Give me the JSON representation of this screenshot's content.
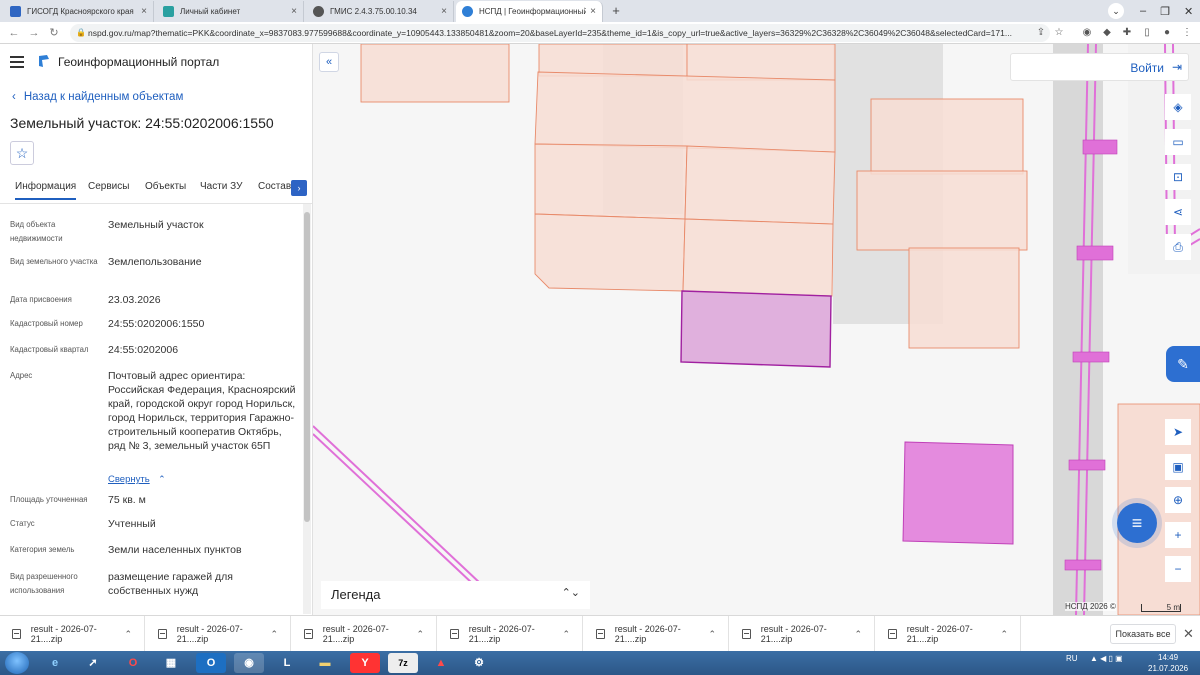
{
  "browser": {
    "tabs": [
      {
        "title": "ГИСОГД Красноярского края",
        "color": "#2f66c2"
      },
      {
        "title": "Личный кабинет",
        "color": "#2aa0a0"
      },
      {
        "title": "ГМИС 2.4.3.75.00.10.34",
        "color": "#555555"
      },
      {
        "title": "НСПД | Геоинформационный п",
        "color": "#2f7fd6"
      }
    ],
    "url": "nspd.gov.ru/map?thematic=PKK&coordinate_x=9837083.977599688&coordinate_y=10905443.133850481&zoom=20&baseLayerId=235&theme_id=1&is_copy_url=true&active_layers=36329%2C36328%2C36049%2C36048&selectedCard=171..."
  },
  "panel": {
    "portal_title": "Геоинформационный портал",
    "back_label": "Назад к найденным объектам",
    "object_title": "Земельный участок: 24:55:0202006:1550",
    "tabs": [
      "Информация",
      "Сервисы",
      "Объекты",
      "Части ЗУ",
      "Состав"
    ],
    "props": [
      {
        "label": "Вид объекта недвижимости",
        "value": "Земельный участок"
      },
      {
        "label": "Вид земельного участка",
        "value": "Землепользование"
      },
      {
        "label": "Дата присвоения",
        "value": "23.03.2026"
      },
      {
        "label": "Кадастровый номер",
        "value": "24:55:0202006:1550"
      },
      {
        "label": "Кадастровый квартал",
        "value": "24:55:0202006"
      },
      {
        "label": "Адрес",
        "value": "Почтовый адрес ориентира: Российская Федерация, Красноярский край, городской округ город Норильск, город Норильск, территория Гаражно-строительный кооператив Октябрь, ряд № 3, земельный участок 65П"
      },
      {
        "label": "Площадь уточненная",
        "value": "75 кв. м"
      },
      {
        "label": "Статус",
        "value": "Учтенный"
      },
      {
        "label": "Категория земель",
        "value": "Земли населенных пунктов"
      },
      {
        "label": "Вид разрешенного использования",
        "value": "размещение гаражей для собственных нужд"
      }
    ],
    "collapse_label": "Свернуть"
  },
  "map": {
    "login_label": "Войти",
    "legend_label": "Легенда",
    "copyright": "НСПД 2026 ©",
    "scale_label": "5 m",
    "colors": {
      "parcel_fill": "#f7ddd4",
      "parcel_stroke": "#e88a6a",
      "selected_fill": "#e0b0dd",
      "selected_stroke": "#a020a0",
      "magenta": "#e070d8"
    }
  },
  "downloads": {
    "items": [
      "result - 2026-07-21....zip",
      "result - 2026-07-21....zip",
      "result - 2026-07-21....zip",
      "result - 2026-07-21....zip",
      "result - 2026-07-21....zip",
      "result - 2026-07-21....zip",
      "result - 2026-07-21....zip"
    ],
    "show_all": "Показать все"
  },
  "taskbar": {
    "lang": "RU",
    "time": "14:49",
    "date": "21.07.2026"
  }
}
